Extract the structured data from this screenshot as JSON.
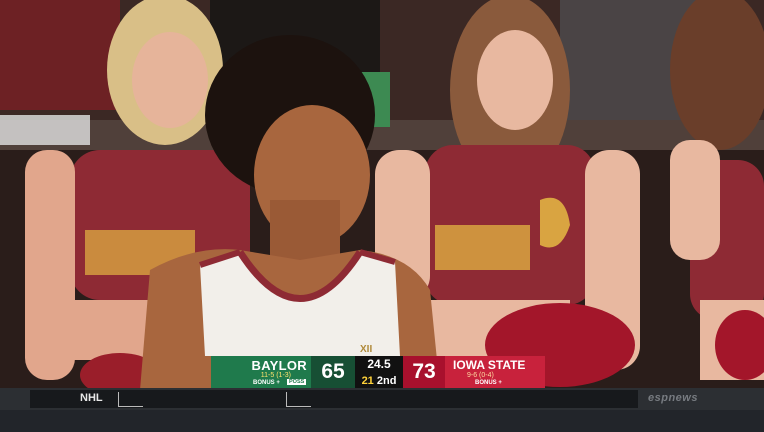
{
  "scorebug": {
    "home": {
      "name": "BAYLOR",
      "record": "11-5 (1-3)",
      "bonus": "BONUS +",
      "poss": "POSS",
      "score": "65"
    },
    "clock": {
      "shot": "24.5",
      "shot_seconds": "21",
      "period": "2nd"
    },
    "away": {
      "name": "IOWA STATE",
      "record": "9-6 (0-4)",
      "bonus": "BONUS +",
      "score": "73"
    }
  },
  "ticker": {
    "league": "NHL",
    "network": "espnews"
  },
  "colors": {
    "home": "#1f7a4c",
    "away": "#c8223c",
    "cardinal": "#8e2a34",
    "gold": "#d9a441"
  }
}
